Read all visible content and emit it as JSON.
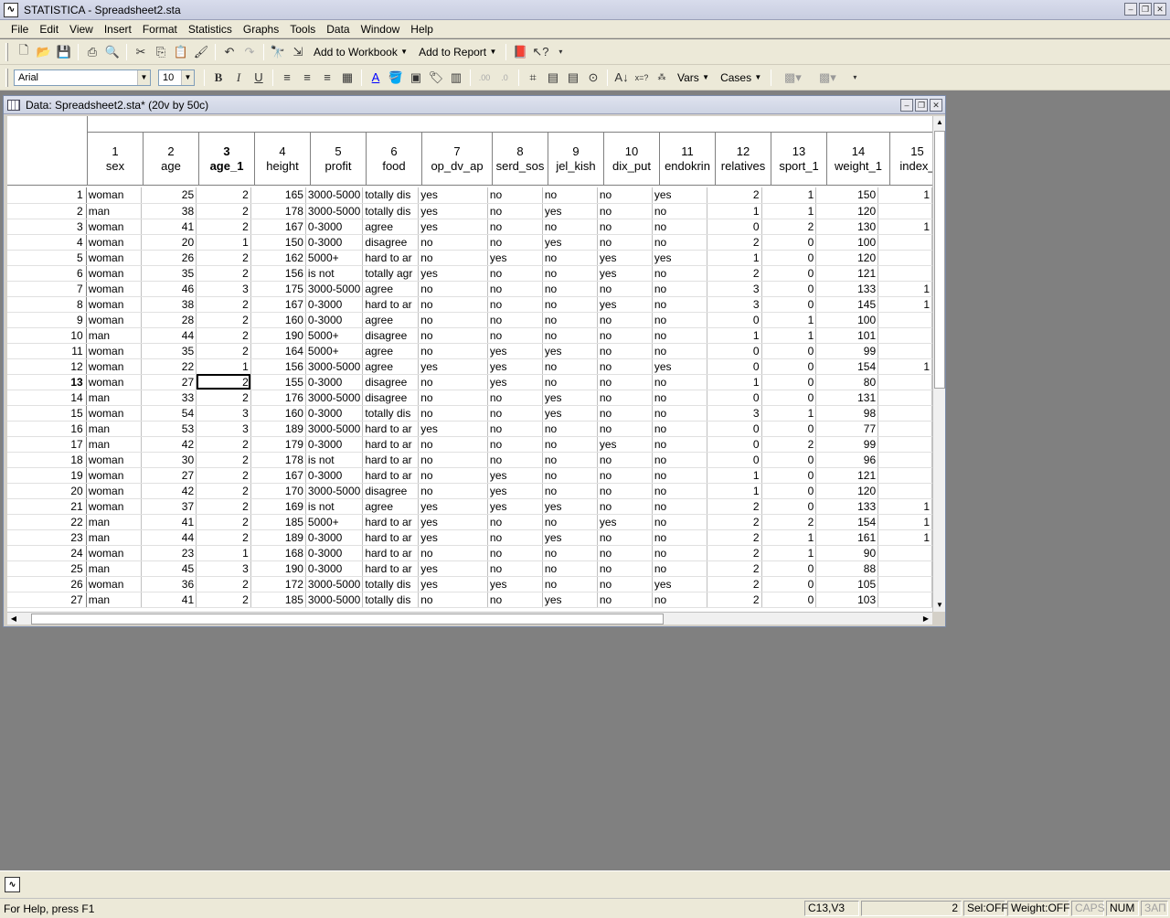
{
  "app": {
    "title": "STATISTICA - Spreadsheet2.sta",
    "icon": "statistica-icon"
  },
  "menu": [
    "File",
    "Edit",
    "View",
    "Insert",
    "Format",
    "Statistics",
    "Graphs",
    "Tools",
    "Data",
    "Window",
    "Help"
  ],
  "toolbar1": {
    "add_to_workbook": "Add to Workbook",
    "add_to_report": "Add to Report"
  },
  "toolbar2": {
    "font_name": "Arial",
    "font_size": "10",
    "vars": "Vars",
    "cases": "Cases"
  },
  "sheet": {
    "title": "Data: Spreadsheet2.sta* (20v by 50c)",
    "columns": [
      {
        "num": "1",
        "name": "sex"
      },
      {
        "num": "2",
        "name": "age"
      },
      {
        "num": "3",
        "name": "age_1"
      },
      {
        "num": "4",
        "name": "height"
      },
      {
        "num": "5",
        "name": "profit"
      },
      {
        "num": "6",
        "name": "food"
      },
      {
        "num": "7",
        "name": "op_dv_ap"
      },
      {
        "num": "8",
        "name": "serd_sos"
      },
      {
        "num": "9",
        "name": "jel_kish"
      },
      {
        "num": "10",
        "name": "dix_put"
      },
      {
        "num": "11",
        "name": "endokrin"
      },
      {
        "num": "12",
        "name": "relatives"
      },
      {
        "num": "13",
        "name": "sport_1"
      },
      {
        "num": "14",
        "name": "weight_1"
      },
      {
        "num": "15",
        "name": "index_"
      }
    ],
    "selected_column": "3",
    "selected_row": "13",
    "rows": [
      [
        "1",
        "woman",
        "25",
        "2",
        "165",
        "3000-5000",
        "totally dis",
        "yes",
        "no",
        "no",
        "no",
        "yes",
        "2",
        "1",
        "150",
        "1"
      ],
      [
        "2",
        "man",
        "38",
        "2",
        "178",
        "3000-5000",
        "totally dis",
        "yes",
        "no",
        "yes",
        "no",
        "no",
        "1",
        "1",
        "120",
        ""
      ],
      [
        "3",
        "woman",
        "41",
        "2",
        "167",
        "0-3000",
        "agree",
        "yes",
        "no",
        "no",
        "no",
        "no",
        "0",
        "2",
        "130",
        "1"
      ],
      [
        "4",
        "woman",
        "20",
        "1",
        "150",
        "0-3000",
        "disagree",
        "no",
        "no",
        "yes",
        "no",
        "no",
        "2",
        "0",
        "100",
        ""
      ],
      [
        "5",
        "woman",
        "26",
        "2",
        "162",
        "5000+",
        "hard to ar",
        "no",
        "yes",
        "no",
        "yes",
        "yes",
        "1",
        "0",
        "120",
        ""
      ],
      [
        "6",
        "woman",
        "35",
        "2",
        "156",
        "is not",
        "totally agr",
        "yes",
        "no",
        "no",
        "yes",
        "no",
        "2",
        "0",
        "121",
        ""
      ],
      [
        "7",
        "woman",
        "46",
        "3",
        "175",
        "3000-5000",
        "agree",
        "no",
        "no",
        "no",
        "no",
        "no",
        "3",
        "0",
        "133",
        "1"
      ],
      [
        "8",
        "woman",
        "38",
        "2",
        "167",
        "0-3000",
        "hard to ar",
        "no",
        "no",
        "no",
        "yes",
        "no",
        "3",
        "0",
        "145",
        "1"
      ],
      [
        "9",
        "woman",
        "28",
        "2",
        "160",
        "0-3000",
        "agree",
        "no",
        "no",
        "no",
        "no",
        "no",
        "0",
        "1",
        "100",
        ""
      ],
      [
        "10",
        "man",
        "44",
        "2",
        "190",
        "5000+",
        "disagree",
        "no",
        "no",
        "no",
        "no",
        "no",
        "1",
        "1",
        "101",
        ""
      ],
      [
        "11",
        "woman",
        "35",
        "2",
        "164",
        "5000+",
        "agree",
        "no",
        "yes",
        "yes",
        "no",
        "no",
        "0",
        "0",
        "99",
        ""
      ],
      [
        "12",
        "woman",
        "22",
        "1",
        "156",
        "3000-5000",
        "agree",
        "yes",
        "yes",
        "no",
        "no",
        "yes",
        "0",
        "0",
        "154",
        "1"
      ],
      [
        "13",
        "woman",
        "27",
        "2",
        "155",
        "0-3000",
        "disagree",
        "no",
        "yes",
        "no",
        "no",
        "no",
        "1",
        "0",
        "80",
        ""
      ],
      [
        "14",
        "man",
        "33",
        "2",
        "176",
        "3000-5000",
        "disagree",
        "no",
        "no",
        "yes",
        "no",
        "no",
        "0",
        "0",
        "131",
        ""
      ],
      [
        "15",
        "woman",
        "54",
        "3",
        "160",
        "0-3000",
        "totally dis",
        "no",
        "no",
        "yes",
        "no",
        "no",
        "3",
        "1",
        "98",
        ""
      ],
      [
        "16",
        "man",
        "53",
        "3",
        "189",
        "3000-5000",
        "hard to ar",
        "yes",
        "no",
        "no",
        "no",
        "no",
        "0",
        "0",
        "77",
        ""
      ],
      [
        "17",
        "man",
        "42",
        "2",
        "179",
        "0-3000",
        "hard to ar",
        "no",
        "no",
        "no",
        "yes",
        "no",
        "0",
        "2",
        "99",
        ""
      ],
      [
        "18",
        "woman",
        "30",
        "2",
        "178",
        "is not",
        "hard to ar",
        "no",
        "no",
        "no",
        "no",
        "no",
        "0",
        "0",
        "96",
        ""
      ],
      [
        "19",
        "woman",
        "27",
        "2",
        "167",
        "0-3000",
        "hard to ar",
        "no",
        "yes",
        "no",
        "no",
        "no",
        "1",
        "0",
        "121",
        ""
      ],
      [
        "20",
        "woman",
        "42",
        "2",
        "170",
        "3000-5000",
        "disagree",
        "no",
        "yes",
        "no",
        "no",
        "no",
        "1",
        "0",
        "120",
        ""
      ],
      [
        "21",
        "woman",
        "37",
        "2",
        "169",
        "is not",
        "agree",
        "yes",
        "yes",
        "yes",
        "no",
        "no",
        "2",
        "0",
        "133",
        "1"
      ],
      [
        "22",
        "man",
        "41",
        "2",
        "185",
        "5000+",
        "hard to ar",
        "yes",
        "no",
        "no",
        "yes",
        "no",
        "2",
        "2",
        "154",
        "1"
      ],
      [
        "23",
        "man",
        "44",
        "2",
        "189",
        "0-3000",
        "hard to ar",
        "yes",
        "no",
        "yes",
        "no",
        "no",
        "2",
        "1",
        "161",
        "1"
      ],
      [
        "24",
        "woman",
        "23",
        "1",
        "168",
        "0-3000",
        "hard to ar",
        "no",
        "no",
        "no",
        "no",
        "no",
        "2",
        "1",
        "90",
        ""
      ],
      [
        "25",
        "man",
        "45",
        "3",
        "190",
        "0-3000",
        "hard to ar",
        "yes",
        "no",
        "no",
        "no",
        "no",
        "2",
        "0",
        "88",
        ""
      ],
      [
        "26",
        "woman",
        "36",
        "2",
        "172",
        "3000-5000",
        "totally dis",
        "yes",
        "yes",
        "no",
        "no",
        "yes",
        "2",
        "0",
        "105",
        ""
      ],
      [
        "27",
        "man",
        "41",
        "2",
        "185",
        "3000-5000",
        "totally dis",
        "no",
        "no",
        "yes",
        "no",
        "no",
        "2",
        "0",
        "103",
        ""
      ]
    ]
  },
  "status": {
    "help": "For Help, press F1",
    "cell_ref": "C13,V3",
    "cell_value": "2",
    "sel": "Sel:OFF",
    "weight": "Weight:OFF",
    "caps": "CAPS",
    "num": "NUM",
    "zap": "ЗАП"
  }
}
